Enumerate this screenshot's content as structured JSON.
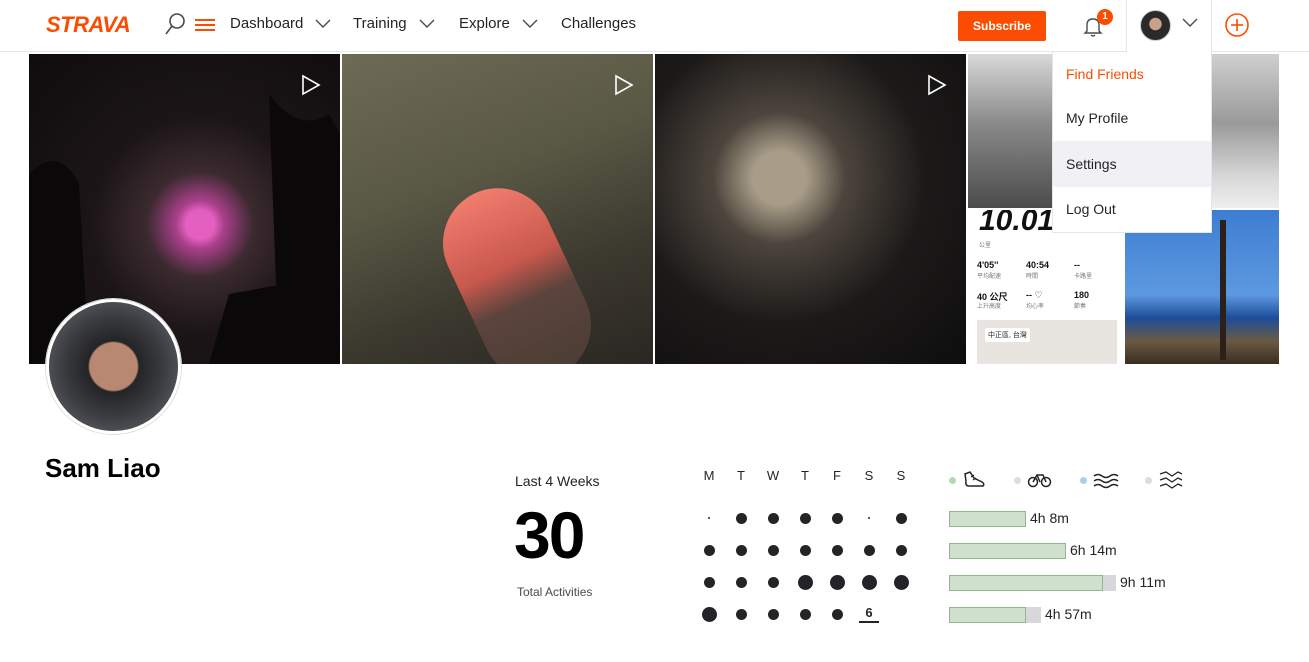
{
  "header": {
    "logo": "STRAVA",
    "nav": [
      "Dashboard",
      "Training",
      "Explore",
      "Challenges"
    ],
    "subscribe_label": "Subscribe",
    "notification_count": "1"
  },
  "user_menu": {
    "items": [
      "Find Friends",
      "My Profile",
      "Settings",
      "Log Out"
    ]
  },
  "photo_overlay": {
    "distance": "10.01",
    "unit_label": "公里",
    "stats": [
      {
        "value": "4'05''",
        "label": "平均配速"
      },
      {
        "value": "40:54",
        "label": "時間"
      },
      {
        "value": "--",
        "label": "卡路里"
      },
      {
        "value": "40 公尺",
        "label": "上升高度"
      },
      {
        "value": "-- ♡",
        "label": "均心率"
      },
      {
        "value": "180",
        "label": "節奏"
      }
    ],
    "map_label": "中正區, 台灣"
  },
  "profile": {
    "name": "Sam Liao"
  },
  "stats": {
    "period_label": "Last 4 Weeks",
    "total_activities": "30",
    "total_label": "Total Activities",
    "day_headers": [
      "M",
      "T",
      "W",
      "T",
      "F",
      "S",
      "S"
    ],
    "today_label": "6",
    "weeks": [
      [
        0,
        2,
        2,
        2,
        2,
        0,
        2
      ],
      [
        2,
        2,
        2,
        2,
        2,
        2,
        2
      ],
      [
        2,
        2,
        2,
        3,
        3,
        3,
        3
      ],
      [
        3,
        2,
        2,
        2,
        2,
        -1,
        -1
      ]
    ],
    "sport_icons": [
      {
        "icon": "run-shoe-icon",
        "color": "#b7d7b4",
        "active": true
      },
      {
        "icon": "bike-icon",
        "color": "#dcdce0",
        "active": false
      },
      {
        "icon": "swim-icon",
        "color": "#a8d3e6",
        "active": false
      },
      {
        "icon": "other-activity-icon",
        "color": "#dcdce0",
        "active": false
      }
    ],
    "weekly_time": [
      {
        "label": "4h 8m",
        "fraction": 0.46,
        "track": 0.46
      },
      {
        "label": "6h 14m",
        "fraction": 0.7,
        "track": 0.7
      },
      {
        "label": "9h 11m",
        "fraction": 0.92,
        "track": 1.0
      },
      {
        "label": "4h 57m",
        "fraction": 0.46,
        "track": 0.55
      }
    ]
  },
  "colors": {
    "brand": "#fc4c02",
    "text": "#242428"
  }
}
